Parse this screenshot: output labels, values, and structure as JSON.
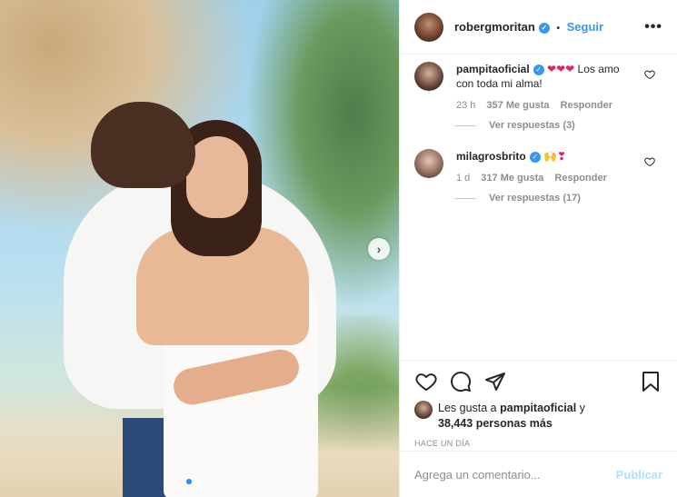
{
  "header": {
    "username": "robergmoritan",
    "separator": "•",
    "follow_label": "Seguir",
    "more_label": "•••"
  },
  "comments": [
    {
      "username": "pampitaoficial",
      "emoji": "❤❤❤",
      "text": "Los amo con toda mi alma!",
      "age": "23 h",
      "likes": "357 Me gusta",
      "reply_label": "Responder",
      "view_replies": "Ver respuestas (3)"
    },
    {
      "username": "milagrosbrito",
      "emoji": "🙌❣",
      "text": "",
      "age": "1 d",
      "likes": "317 Me gusta",
      "reply_label": "Responder",
      "view_replies": "Ver respuestas (17)"
    }
  ],
  "likes_summary": {
    "prefix": "Les gusta a",
    "user": "pampitaoficial",
    "conjunction": "y",
    "others": "38,443 personas más"
  },
  "timestamp": "HACE UN DÍA",
  "comment_box": {
    "placeholder": "Agrega un comentario...",
    "publish_label": "Publicar"
  },
  "icons": {
    "like": "heart-icon",
    "comment": "comment-icon",
    "share": "share-icon",
    "save": "bookmark-icon",
    "next": "chevron-right-icon"
  },
  "colors": {
    "link_blue": "#3897f0",
    "publish_disabled": "#b2dffc",
    "muted_text": "#8e8e8e",
    "heart_red": "#e0245e"
  }
}
